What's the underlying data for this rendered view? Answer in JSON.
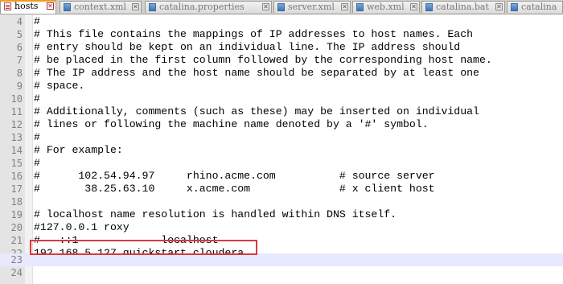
{
  "tabs": [
    {
      "label": "hosts",
      "active": true
    },
    {
      "label": "context.xml",
      "active": false
    },
    {
      "label": "catalina.properties",
      "active": false
    },
    {
      "label": "server.xml",
      "active": false
    },
    {
      "label": "web.xml",
      "active": false
    },
    {
      "label": "catalina.bat",
      "active": false
    },
    {
      "label": "catalina",
      "active": false
    }
  ],
  "tab_close_glyph": "✕",
  "nav": {
    "left": "◀",
    "right": "▶"
  },
  "editor": {
    "current_line": "23",
    "highlighted_line": "22",
    "lines": [
      {
        "num": "4",
        "text": "#"
      },
      {
        "num": "5",
        "text": "# This file contains the mappings of IP addresses to host names. Each"
      },
      {
        "num": "6",
        "text": "# entry should be kept on an individual line. The IP address should"
      },
      {
        "num": "7",
        "text": "# be placed in the first column followed by the corresponding host name."
      },
      {
        "num": "8",
        "text": "# The IP address and the host name should be separated by at least one"
      },
      {
        "num": "9",
        "text": "# space."
      },
      {
        "num": "10",
        "text": "#"
      },
      {
        "num": "11",
        "text": "# Additionally, comments (such as these) may be inserted on individual"
      },
      {
        "num": "12",
        "text": "# lines or following the machine name denoted by a '#' symbol."
      },
      {
        "num": "13",
        "text": "#"
      },
      {
        "num": "14",
        "text": "# For example:"
      },
      {
        "num": "15",
        "text": "#"
      },
      {
        "num": "16",
        "text": "#      102.54.94.97     rhino.acme.com          # source server"
      },
      {
        "num": "17",
        "text": "#       38.25.63.10     x.acme.com              # x client host"
      },
      {
        "num": "18",
        "text": ""
      },
      {
        "num": "19",
        "text": "# localhost name resolution is handled within DNS itself."
      },
      {
        "num": "20",
        "text": "#127.0.0.1 roxy"
      },
      {
        "num": "21",
        "text": "#   ::1             localhost"
      },
      {
        "num": "22",
        "text": "192.168.5.127 quickstart.cloudera"
      },
      {
        "num": "23",
        "text": ""
      },
      {
        "num": "24",
        "text": ""
      }
    ]
  }
}
